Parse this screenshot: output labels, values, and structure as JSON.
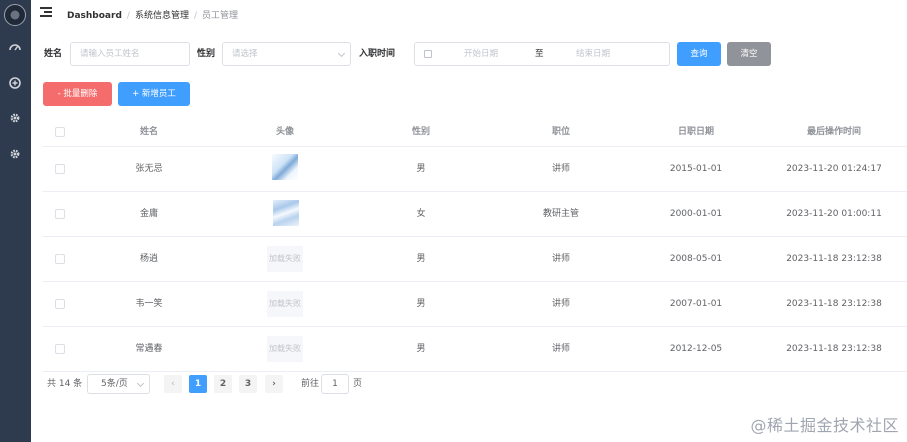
{
  "sidebar": {
    "icons": [
      "dashboard-icon",
      "plus-circle-icon",
      "gear-icon",
      "gear-icon"
    ]
  },
  "breadcrumb": {
    "home": "Dashboard",
    "section": "系统信息管理",
    "current": "员工管理",
    "separator": "/"
  },
  "filter": {
    "name_label": "姓名",
    "name_placeholder": "请输入员工姓名",
    "gender_label": "性别",
    "gender_placeholder": "请选择",
    "hire_label": "入职时间",
    "start_placeholder": "开始日期",
    "range_sep": "至",
    "end_placeholder": "结束日期",
    "query_label": "查询",
    "clear_label": "清空"
  },
  "actions": {
    "batch_delete": "- 批量删除",
    "add_employee": "+ 新增员工"
  },
  "table": {
    "headers": [
      "姓名",
      "头像",
      "性别",
      "职位",
      "日职日期",
      "最后操作时间"
    ],
    "rows": [
      {
        "name": "张无忌",
        "avatar": "image",
        "gender": "男",
        "position": "讲师",
        "date": "2015-01-01",
        "updated": "2023-11-20 01:24:17"
      },
      {
        "name": "金庸",
        "avatar": "image",
        "gender": "女",
        "position": "教研主管",
        "date": "2000-01-01",
        "updated": "2023-11-20 01:00:11"
      },
      {
        "name": "杨逍",
        "avatar": "加载失败",
        "gender": "男",
        "position": "讲师",
        "date": "2008-05-01",
        "updated": "2023-11-18 23:12:38"
      },
      {
        "name": "韦一笑",
        "avatar": "加载失败",
        "gender": "男",
        "position": "讲师",
        "date": "2007-01-01",
        "updated": "2023-11-18 23:12:38"
      },
      {
        "name": "常遇春",
        "avatar": "加载失败",
        "gender": "男",
        "position": "讲师",
        "date": "2012-12-05",
        "updated": "2023-11-18 23:12:38"
      }
    ]
  },
  "pagination": {
    "total": "共 14 条",
    "page_size": "5条/页",
    "pages": [
      "1",
      "2",
      "3"
    ],
    "current_page": "1",
    "prev": "‹",
    "next": "›",
    "goto_label": "前往",
    "goto_value": "1",
    "goto_suffix": "页"
  },
  "watermark": "@稀土掘金技术社区",
  "colors": {
    "sidebar": "#2e3a4d",
    "primary": "#409eff",
    "danger": "#f56c6c",
    "info": "#909399"
  }
}
